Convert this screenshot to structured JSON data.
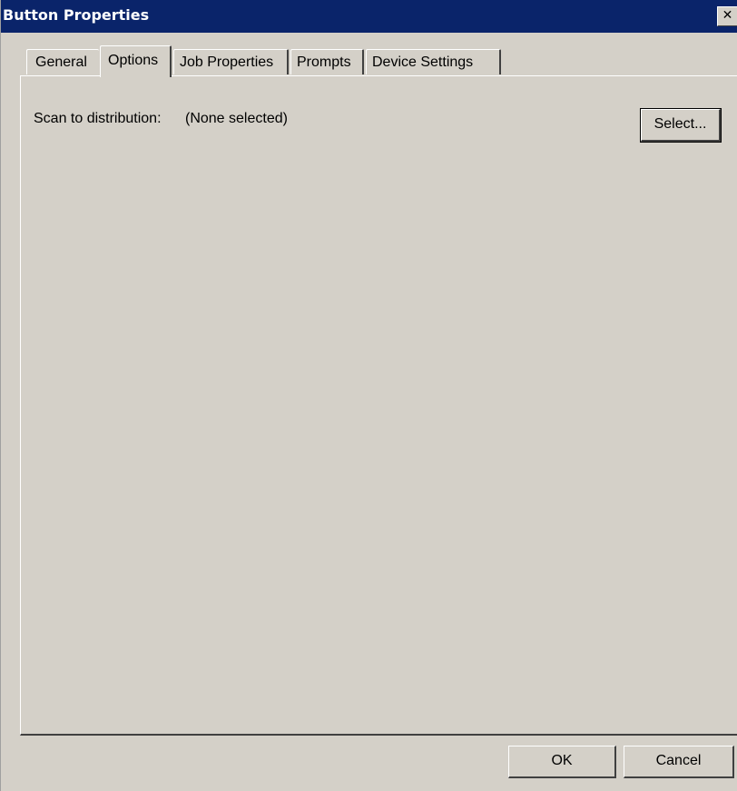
{
  "window": {
    "title": "Button Properties",
    "close_glyph": "✕"
  },
  "tabs": [
    {
      "label": "General",
      "active": false
    },
    {
      "label": "Options",
      "active": true
    },
    {
      "label": "Job Properties",
      "active": false
    },
    {
      "label": "Prompts",
      "active": false
    },
    {
      "label": "Device Settings",
      "active": false
    }
  ],
  "options": {
    "scan_label": "Scan to distribution:",
    "scan_value": "(None selected)",
    "select_button": "Select..."
  },
  "footer": {
    "ok_label": "OK",
    "cancel_label": "Cancel"
  },
  "colors": {
    "titlebar": "#0a246a",
    "face": "#d4d0c8"
  }
}
